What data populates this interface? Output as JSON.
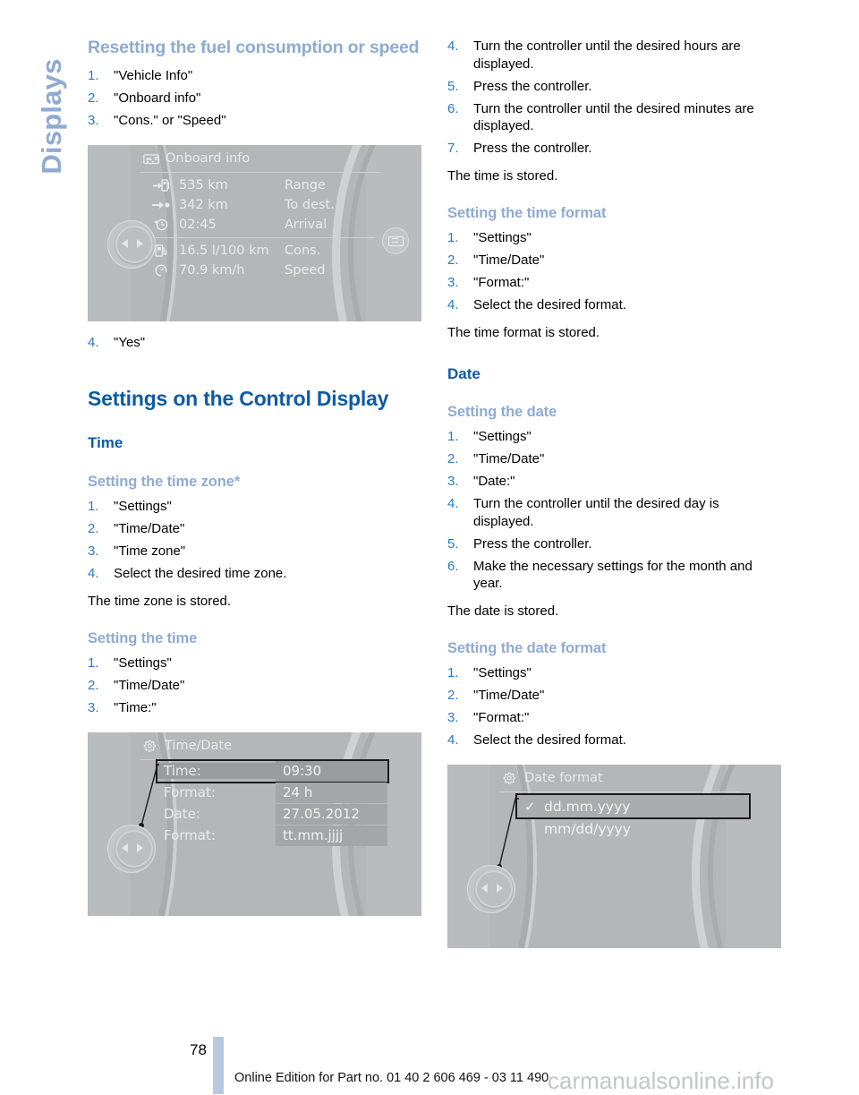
{
  "sidebar": {
    "chapter_label": "Displays"
  },
  "left_column": {
    "heading_reset": "Resetting the fuel consumption or speed",
    "reset_steps": [
      {
        "num": "1.",
        "text": "\"Vehicle Info\""
      },
      {
        "num": "2.",
        "text": "\"Onboard info\""
      },
      {
        "num": "3.",
        "text": "\"Cons.\" or \"Speed\""
      }
    ],
    "reset_step_after": {
      "num": "4.",
      "text": "\"Yes\""
    },
    "heading_settings": "Settings on the Control Display",
    "heading_time": "Time",
    "heading_timezone": "Setting the time zone*",
    "timezone_steps": [
      {
        "num": "1.",
        "text": "\"Settings\""
      },
      {
        "num": "2.",
        "text": "\"Time/Date\""
      },
      {
        "num": "3.",
        "text": "\"Time zone\""
      },
      {
        "num": "4.",
        "text": "Select the desired time zone."
      }
    ],
    "timezone_result": "The time zone is stored.",
    "heading_settime": "Setting the time",
    "settime_steps": [
      {
        "num": "1.",
        "text": "\"Settings\""
      },
      {
        "num": "2.",
        "text": "\"Time/Date\""
      },
      {
        "num": "3.",
        "text": "\"Time:\""
      }
    ]
  },
  "right_column": {
    "time_steps_continued": [
      {
        "num": "4.",
        "text": "Turn the controller until the desired hours are displayed."
      },
      {
        "num": "5.",
        "text": "Press the controller."
      },
      {
        "num": "6.",
        "text": "Turn the controller until the desired minutes are displayed."
      },
      {
        "num": "7.",
        "text": "Press the controller."
      }
    ],
    "time_result": "The time is stored.",
    "heading_timeformat": "Setting the time format",
    "timeformat_steps": [
      {
        "num": "1.",
        "text": "\"Settings\""
      },
      {
        "num": "2.",
        "text": "\"Time/Date\""
      },
      {
        "num": "3.",
        "text": "\"Format:\""
      },
      {
        "num": "4.",
        "text": "Select the desired format."
      }
    ],
    "timeformat_result": "The time format is stored.",
    "heading_date": "Date",
    "heading_setdate": "Setting the date",
    "setdate_steps": [
      {
        "num": "1.",
        "text": "\"Settings\""
      },
      {
        "num": "2.",
        "text": "\"Time/Date\""
      },
      {
        "num": "3.",
        "text": "\"Date:\""
      },
      {
        "num": "4.",
        "text": "Turn the controller until the desired day is displayed."
      },
      {
        "num": "5.",
        "text": "Press the controller."
      },
      {
        "num": "6.",
        "text": "Make the necessary settings for the month and year."
      }
    ],
    "setdate_result": "The date is stored.",
    "heading_dateformat": "Setting the date format",
    "dateformat_steps": [
      {
        "num": "1.",
        "text": "\"Settings\""
      },
      {
        "num": "2.",
        "text": "\"Time/Date\""
      },
      {
        "num": "3.",
        "text": "\"Format:\""
      },
      {
        "num": "4.",
        "text": "Select the desired format."
      }
    ]
  },
  "figure_onboard": {
    "title": "Onboard info",
    "rows": [
      {
        "icon": "fuel-pump-arrow-icon",
        "value": "535 km",
        "label": "Range"
      },
      {
        "icon": "arrow-destination-icon",
        "value": "342 km",
        "label": "To dest."
      },
      {
        "icon": "clock-arrival-icon",
        "value": "02:45",
        "label": "Arrival"
      },
      {
        "icon": "fuel-pump-icon",
        "value": "16.5 l/100 km",
        "label": "Cons."
      },
      {
        "icon": "speedometer-icon",
        "value": "70.9 km/h",
        "label": "Speed"
      }
    ]
  },
  "figure_timedate": {
    "title": "Time/Date",
    "rows": [
      {
        "label": "Time:",
        "value": "09:30",
        "selected": true
      },
      {
        "label": "Format:",
        "value": "24 h",
        "selected": false
      },
      {
        "label": "Date:",
        "value": "27.05.2012",
        "selected": false
      },
      {
        "label": "Format:",
        "value": "tt.mm.jjjj",
        "selected": false
      }
    ]
  },
  "figure_dateformat": {
    "title": "Date format",
    "options": [
      {
        "check": "✓",
        "label": "dd.mm.yyyy",
        "selected": true
      },
      {
        "check": "",
        "label": "mm/dd/yyyy",
        "selected": false
      }
    ]
  },
  "footer": {
    "page_number": "78",
    "edition_text": "Online Edition for Part no. 01 40 2 606 469 - 03 11 490",
    "watermark": "carmanualsonline.info"
  },
  "colors": {
    "heading_dark_blue": "#0d5ba5",
    "heading_light_blue": "#8fabd2",
    "list_number_blue": "#2a7ac4",
    "page_bar": "#b8c8e0"
  }
}
